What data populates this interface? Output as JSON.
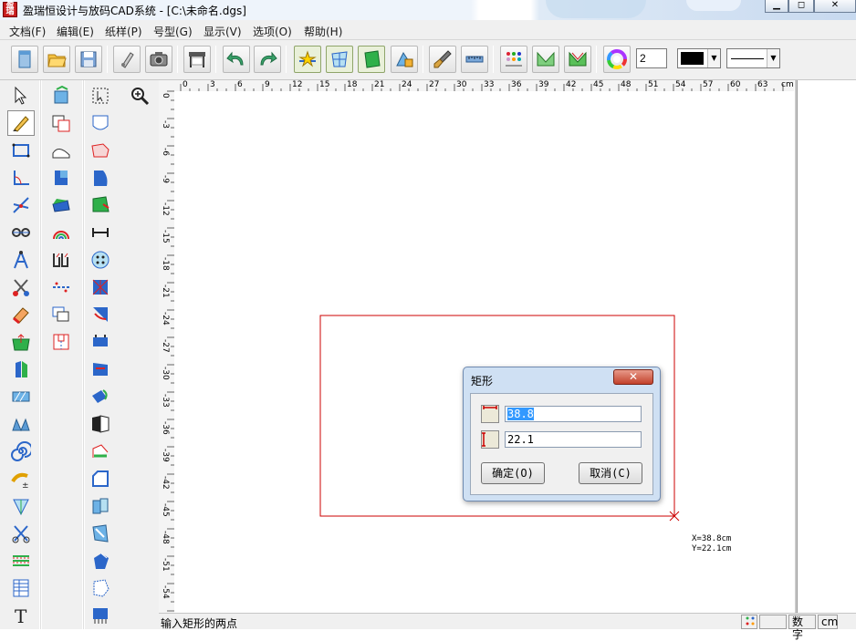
{
  "window": {
    "title": "盈瑞恒设计与放码CAD系统 - [C:\\未命名.dgs]",
    "app_icon_text": "盈瑞"
  },
  "menu": {
    "items": [
      "文档(F)",
      "编辑(E)",
      "纸样(P)",
      "号型(G)",
      "显示(V)",
      "选项(O)",
      "帮助(H)"
    ]
  },
  "toolbar": {
    "number_value": "2",
    "line_color": "#000000"
  },
  "ruler": {
    "h_ticks": [
      "0",
      "3",
      "6",
      "9",
      "12",
      "15",
      "18",
      "21",
      "24",
      "27",
      "30",
      "33",
      "36",
      "39",
      "42",
      "45",
      "48",
      "51",
      "54",
      "57",
      "60",
      "63"
    ],
    "h_unit": "cm",
    "v_ticks": [
      "0",
      "-3",
      "-6",
      "-9",
      "-12",
      "-15",
      "-18",
      "-21",
      "-24",
      "-27",
      "-30",
      "-33",
      "-36",
      "-39",
      "-42",
      "-45",
      "-48",
      "-51",
      "-54",
      "-57"
    ]
  },
  "dialog": {
    "title": "矩形",
    "width_value_selected": "38.8",
    "height_value": "22.1",
    "ok_label": "确定(O)",
    "cancel_label": "取消(C)"
  },
  "cursor_readout": {
    "x_text": "X=38.8cm",
    "y_text": "Y=22.1cm"
  },
  "status": {
    "prompt": "输入矩形的两点",
    "mode": "数字",
    "unit": "cm"
  },
  "colors": {
    "rect_stroke": "#cc0000",
    "dialog_frame": "#cfe0f3",
    "close_button": "#c2412b"
  }
}
